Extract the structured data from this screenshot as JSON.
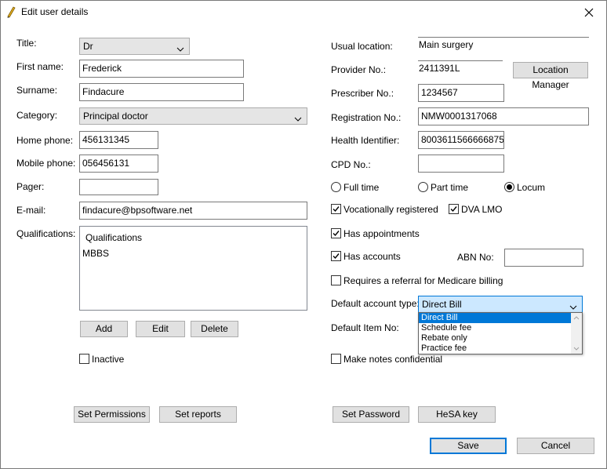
{
  "window": {
    "title": "Edit user details"
  },
  "left": {
    "title_label": "Title:",
    "title_value": "Dr",
    "firstname_label": "First name:",
    "firstname_value": "Frederick",
    "surname_label": "Surname:",
    "surname_value": "Findacure",
    "category_label": "Category:",
    "category_value": "Principal doctor",
    "homephone_label": "Home phone:",
    "homephone_value": "456131345",
    "mobile_label": "Mobile phone:",
    "mobile_value": "056456131",
    "pager_label": "Pager:",
    "pager_value": "",
    "email_label": "E-mail:",
    "email_value": "findacure@bpsoftware.net",
    "qualifications_label": "Qualifications:",
    "qualifications_header": "Qualifications",
    "qualifications_items": [
      "MBBS"
    ],
    "add_label": "Add",
    "edit_label": "Edit",
    "delete_label": "Delete",
    "inactive_label": "Inactive",
    "inactive_checked": false,
    "set_permissions_label": "Set Permissions",
    "set_reports_label": "Set reports"
  },
  "right": {
    "usual_location_label": "Usual location:",
    "usual_location_value": "Main surgery",
    "provider_label": "Provider No.:",
    "provider_value": "2411391L",
    "location_manager_label": "Location Manager",
    "prescriber_label": "Prescriber No.:",
    "prescriber_value": "1234567",
    "registration_label": "Registration No.:",
    "registration_value": "NMW0001317068",
    "health_id_label": "Health Identifier:",
    "health_id_value": "8003611566666875",
    "cpd_label": "CPD No.:",
    "cpd_value": "",
    "full_time_label": "Full time",
    "part_time_label": "Part time",
    "locum_label": "Locum",
    "employment_selected": "Locum",
    "vocational_label": "Vocationally registered",
    "vocational_checked": true,
    "dva_label": "DVA LMO",
    "dva_checked": true,
    "has_appointments_label": "Has appointments",
    "has_appointments_checked": true,
    "has_accounts_label": "Has accounts",
    "has_accounts_checked": true,
    "abn_label": "ABN No:",
    "abn_value": "",
    "referral_label": "Requires a referral for Medicare billing",
    "referral_checked": false,
    "default_account_label": "Default account type:",
    "default_account_value": "Direct Bill",
    "account_options": [
      "Direct Bill",
      "Schedule fee",
      "Rebate only",
      "Practice fee"
    ],
    "default_item_label": "Default Item No:",
    "confidential_label": "Make notes confidential",
    "confidential_checked": false,
    "set_password_label": "Set Password",
    "hesa_label": "HeSA key"
  },
  "footer": {
    "save_label": "Save",
    "cancel_label": "Cancel"
  },
  "colors": {
    "selection": "#0078d7",
    "default_button_border": "#0078d7",
    "combo_focus_bg": "#cce8ff"
  }
}
